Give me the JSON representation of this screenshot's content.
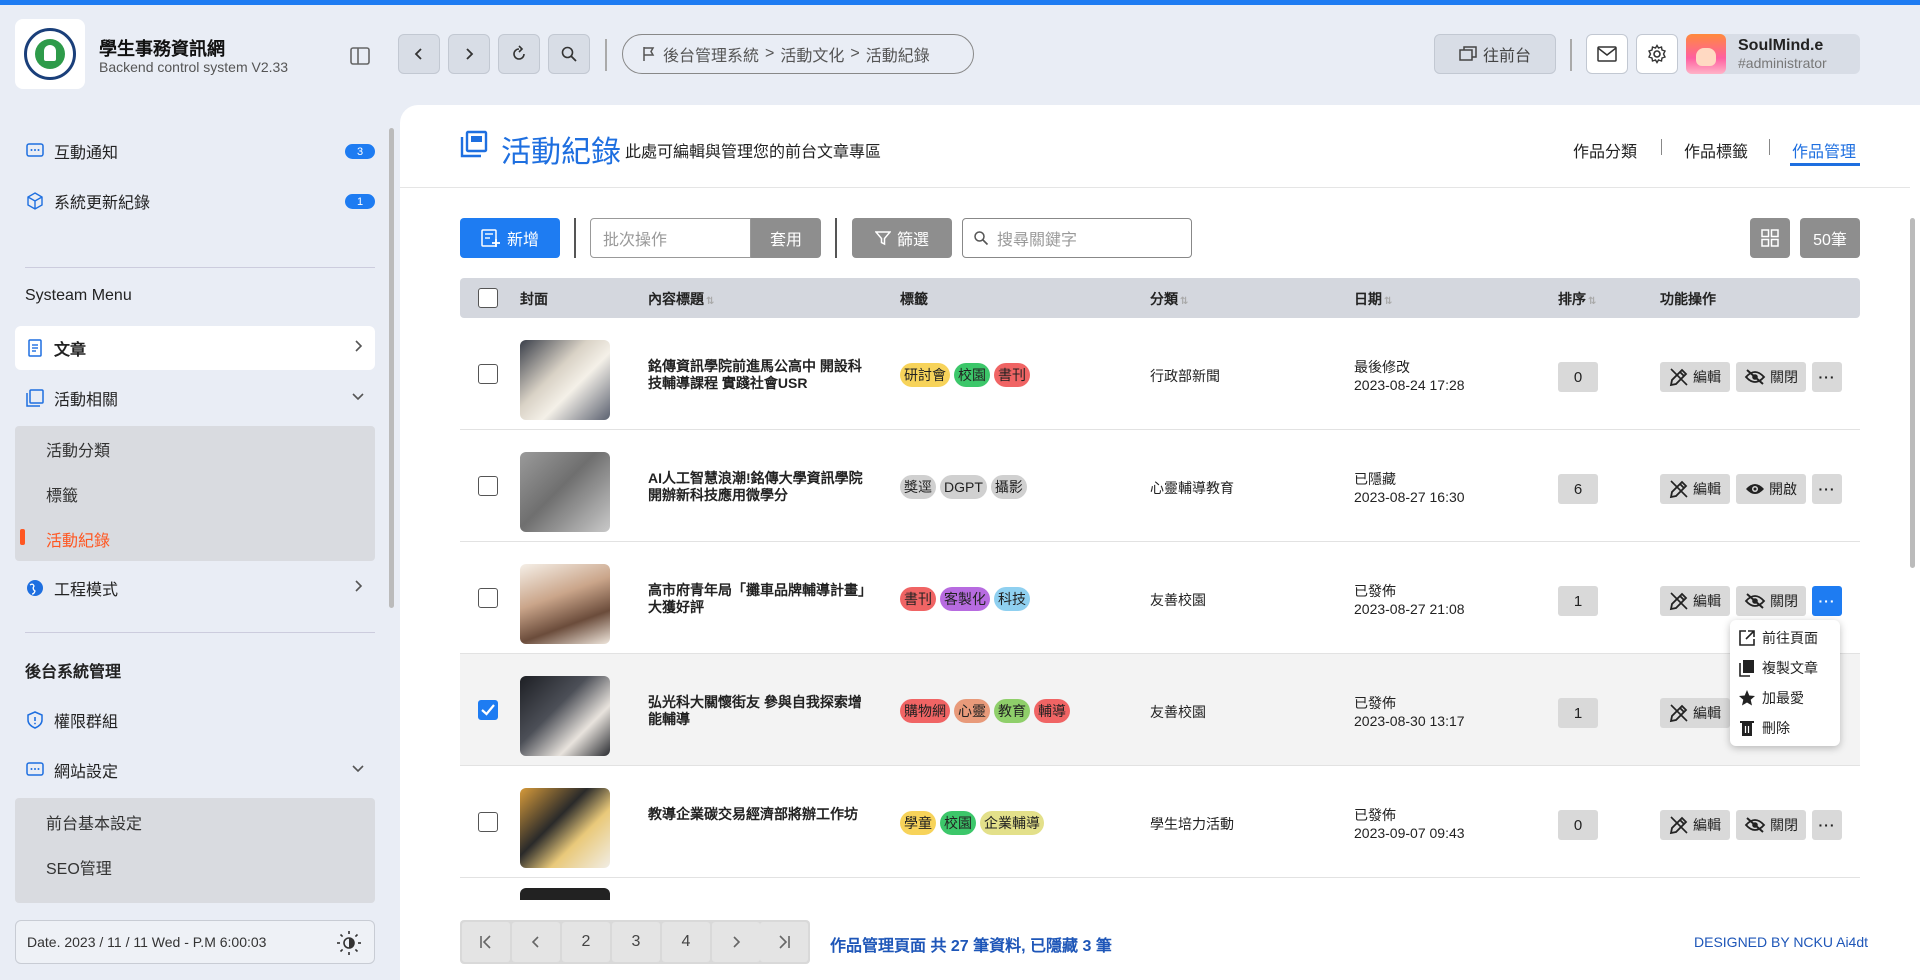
{
  "header": {
    "brand_title": "學生事務資訊網",
    "brand_subtitle": "Backend control system V2.33",
    "breadcrumb": [
      "後台管理系統",
      "活動文化",
      "活動紀錄"
    ],
    "front_button": "往前台",
    "user_name": "SoulMind.e",
    "user_role": "#administrator"
  },
  "sidebar": {
    "notices": [
      {
        "label": "互動通知",
        "count": "3"
      },
      {
        "label": "系統更新紀錄",
        "count": "1"
      }
    ],
    "menu_section": "Systeam Menu",
    "menu": {
      "article": "文章",
      "activity": "活動相關",
      "activity_sub": [
        "活動分類",
        "標籤",
        "活動紀錄"
      ],
      "engineering": "工程模式"
    },
    "admin_section": "後台系統管理",
    "admin": {
      "permission": "權限群組",
      "website": "網站設定",
      "website_sub": [
        "前台基本設定",
        "SEO管理"
      ]
    },
    "date": "Date. 2023 / 11 / 11 Wed - P.M 6:00:03"
  },
  "page": {
    "title": "活動紀錄",
    "description": "此處可編輯與管理您的前台文章專區",
    "tabs": [
      "作品分類",
      "作品標籤",
      "作品管理"
    ],
    "active_tab": "作品管理"
  },
  "toolbar": {
    "new_label": "新增",
    "batch_placeholder": "批次操作",
    "apply_label": "套用",
    "filter_label": "篩選",
    "search_placeholder": "搜尋關鍵字",
    "count_label": "50筆"
  },
  "table": {
    "columns": [
      "封面",
      "內容標題",
      "標籤",
      "分類",
      "日期",
      "排序",
      "功能操作"
    ],
    "rows": [
      {
        "title": "銘傳資訊學院前進馬公高中 開設科技輔導課程 實踐社會USR",
        "tags": [
          {
            "t": "研討會",
            "c": "#f7d35a"
          },
          {
            "t": "校園",
            "c": "#3cc76a"
          },
          {
            "t": "書刊",
            "c": "#f06464"
          }
        ],
        "category": "行政部新聞",
        "date_label": "最後修改",
        "date": "2023-08-24 17:28",
        "order": "0",
        "visibility": "關閉",
        "checked": false
      },
      {
        "title": "AI人工智慧浪潮!銘傳大學資訊學院開辦新科技應用微學分",
        "tags": [
          {
            "t": "獎逕",
            "c": "#d0d0d0"
          },
          {
            "t": "DGPT",
            "c": "#d0d0d0"
          },
          {
            "t": "攝影",
            "c": "#d0d0d0"
          }
        ],
        "category": "心靈輔導教育",
        "date_label": "已隱藏",
        "date": "2023-08-27 16:30",
        "order": "6",
        "visibility": "開啟",
        "checked": false
      },
      {
        "title": "高市府青年局「攤車品牌輔導計畫」大獲好評",
        "tags": [
          {
            "t": "書刊",
            "c": "#f06464"
          },
          {
            "t": "客製化",
            "c": "#b76be0"
          },
          {
            "t": "科技",
            "c": "#8fd0f0"
          }
        ],
        "category": "友善校園",
        "date_label": "已發佈",
        "date": "2023-08-27 21:08",
        "order": "1",
        "visibility": "關閉",
        "checked": false
      },
      {
        "title": "弘光科大關懷街友 參與自我探索增能輔導",
        "tags": [
          {
            "t": "購物網",
            "c": "#f06464"
          },
          {
            "t": "心靈",
            "c": "#e89a7a"
          },
          {
            "t": "教育",
            "c": "#8fcf6a"
          },
          {
            "t": "輔導",
            "c": "#f06464"
          }
        ],
        "category": "友善校園",
        "date_label": "已發佈",
        "date": "2023-08-30 13:17",
        "order": "1",
        "visibility": "",
        "checked": true
      },
      {
        "title": "教導企業碳交易經濟部將辦工作坊",
        "tags": [
          {
            "t": "學童",
            "c": "#f7d35a"
          },
          {
            "t": "校園",
            "c": "#3cc76a"
          },
          {
            "t": "企業輔導",
            "c": "#e3e08a"
          }
        ],
        "category": "學生培力活動",
        "date_label": "已發佈",
        "date": "2023-09-07 09:43",
        "order": "0",
        "visibility": "關閉",
        "checked": false
      }
    ],
    "edit_label": "編輯",
    "more_label": "···"
  },
  "dropdown": [
    "前往頁面",
    "複製文章",
    "加最愛",
    "刪除"
  ],
  "footer": {
    "pages": [
      "2",
      "3",
      "4"
    ],
    "info": "作品管理頁面 共 27 筆資料, 已隱藏 3 筆",
    "designed": "DESIGNED BY NCKU Ai4dt"
  }
}
